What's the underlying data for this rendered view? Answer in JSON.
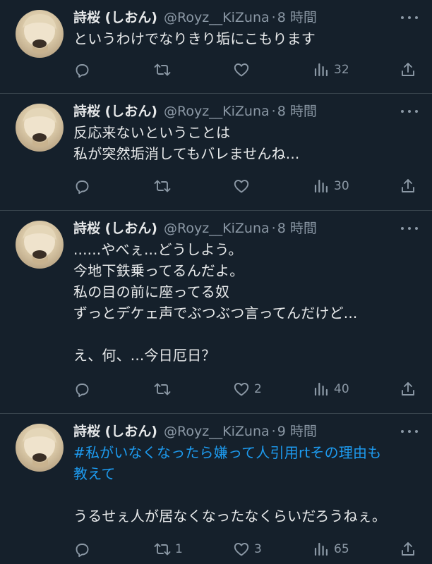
{
  "tweets": [
    {
      "name": "詩桜 (しおん)",
      "handle": "@Royz__KiZuna",
      "dot": "·",
      "time": "8 時間",
      "lines": [
        {
          "text": "というわけでなりきり垢にこもります",
          "hashtag": false
        }
      ],
      "reply_count": "",
      "retweet_count": "",
      "like_count": "",
      "views": "32"
    },
    {
      "name": "詩桜 (しおん)",
      "handle": "@Royz__KiZuna",
      "dot": "·",
      "time": "8 時間",
      "lines": [
        {
          "text": "反応来ないということは",
          "hashtag": false
        },
        {
          "text": "私が突然垢消してもバレませんね...",
          "hashtag": false
        }
      ],
      "reply_count": "",
      "retweet_count": "",
      "like_count": "",
      "views": "30"
    },
    {
      "name": "詩桜 (しおん)",
      "handle": "@Royz__KiZuna",
      "dot": "·",
      "time": "8 時間",
      "lines": [
        {
          "text": "......やべぇ...どうしよう。",
          "hashtag": false
        },
        {
          "text": "今地下鉄乗ってるんだよ。",
          "hashtag": false
        },
        {
          "text": "私の目の前に座ってる奴",
          "hashtag": false
        },
        {
          "text": "ずっとデケェ声でぶつぶつ言ってんだけど...",
          "hashtag": false
        },
        {
          "text": "",
          "hashtag": false
        },
        {
          "text": "え、何、...今日厄日？",
          "hashtag": false
        }
      ],
      "reply_count": "",
      "retweet_count": "",
      "like_count": "2",
      "views": "40"
    },
    {
      "name": "詩桜 (しおん)",
      "handle": "@Royz__KiZuna",
      "dot": "·",
      "time": "9 時間",
      "lines": [
        {
          "text": "#私がいなくなったら嫌って人引用rtその理由も",
          "hashtag": true
        },
        {
          "text": "教えて",
          "hashtag": true
        },
        {
          "text": "",
          "hashtag": false
        },
        {
          "text": "うるせぇ人が居なくなったなくらいだろうねぇ。",
          "hashtag": false
        }
      ],
      "reply_count": "",
      "retweet_count": "1",
      "like_count": "3",
      "views": "65"
    }
  ],
  "icons": {
    "reply": "reply-icon",
    "retweet": "retweet-icon",
    "like": "heart-icon",
    "views": "views-icon",
    "share": "share-icon",
    "more": "more-icon"
  },
  "colors": {
    "background": "#15202b",
    "text": "#e7e9ea",
    "secondary": "#8b98a5",
    "hashtag": "#1d9bf0",
    "divider": "#38444d"
  }
}
